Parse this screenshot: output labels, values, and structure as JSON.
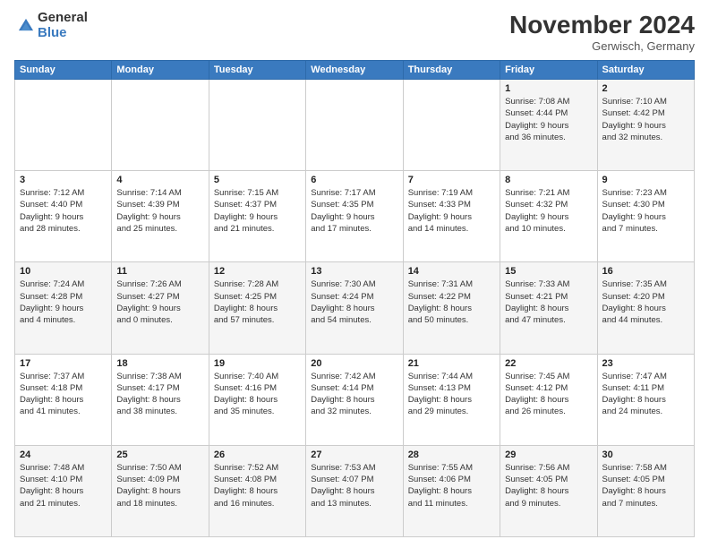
{
  "logo": {
    "general": "General",
    "blue": "Blue"
  },
  "header": {
    "month_title": "November 2024",
    "location": "Gerwisch, Germany"
  },
  "weekdays": [
    "Sunday",
    "Monday",
    "Tuesday",
    "Wednesday",
    "Thursday",
    "Friday",
    "Saturday"
  ],
  "weeks": [
    [
      {
        "day": "",
        "detail": ""
      },
      {
        "day": "",
        "detail": ""
      },
      {
        "day": "",
        "detail": ""
      },
      {
        "day": "",
        "detail": ""
      },
      {
        "day": "",
        "detail": ""
      },
      {
        "day": "1",
        "detail": "Sunrise: 7:08 AM\nSunset: 4:44 PM\nDaylight: 9 hours\nand 36 minutes."
      },
      {
        "day": "2",
        "detail": "Sunrise: 7:10 AM\nSunset: 4:42 PM\nDaylight: 9 hours\nand 32 minutes."
      }
    ],
    [
      {
        "day": "3",
        "detail": "Sunrise: 7:12 AM\nSunset: 4:40 PM\nDaylight: 9 hours\nand 28 minutes."
      },
      {
        "day": "4",
        "detail": "Sunrise: 7:14 AM\nSunset: 4:39 PM\nDaylight: 9 hours\nand 25 minutes."
      },
      {
        "day": "5",
        "detail": "Sunrise: 7:15 AM\nSunset: 4:37 PM\nDaylight: 9 hours\nand 21 minutes."
      },
      {
        "day": "6",
        "detail": "Sunrise: 7:17 AM\nSunset: 4:35 PM\nDaylight: 9 hours\nand 17 minutes."
      },
      {
        "day": "7",
        "detail": "Sunrise: 7:19 AM\nSunset: 4:33 PM\nDaylight: 9 hours\nand 14 minutes."
      },
      {
        "day": "8",
        "detail": "Sunrise: 7:21 AM\nSunset: 4:32 PM\nDaylight: 9 hours\nand 10 minutes."
      },
      {
        "day": "9",
        "detail": "Sunrise: 7:23 AM\nSunset: 4:30 PM\nDaylight: 9 hours\nand 7 minutes."
      }
    ],
    [
      {
        "day": "10",
        "detail": "Sunrise: 7:24 AM\nSunset: 4:28 PM\nDaylight: 9 hours\nand 4 minutes."
      },
      {
        "day": "11",
        "detail": "Sunrise: 7:26 AM\nSunset: 4:27 PM\nDaylight: 9 hours\nand 0 minutes."
      },
      {
        "day": "12",
        "detail": "Sunrise: 7:28 AM\nSunset: 4:25 PM\nDaylight: 8 hours\nand 57 minutes."
      },
      {
        "day": "13",
        "detail": "Sunrise: 7:30 AM\nSunset: 4:24 PM\nDaylight: 8 hours\nand 54 minutes."
      },
      {
        "day": "14",
        "detail": "Sunrise: 7:31 AM\nSunset: 4:22 PM\nDaylight: 8 hours\nand 50 minutes."
      },
      {
        "day": "15",
        "detail": "Sunrise: 7:33 AM\nSunset: 4:21 PM\nDaylight: 8 hours\nand 47 minutes."
      },
      {
        "day": "16",
        "detail": "Sunrise: 7:35 AM\nSunset: 4:20 PM\nDaylight: 8 hours\nand 44 minutes."
      }
    ],
    [
      {
        "day": "17",
        "detail": "Sunrise: 7:37 AM\nSunset: 4:18 PM\nDaylight: 8 hours\nand 41 minutes."
      },
      {
        "day": "18",
        "detail": "Sunrise: 7:38 AM\nSunset: 4:17 PM\nDaylight: 8 hours\nand 38 minutes."
      },
      {
        "day": "19",
        "detail": "Sunrise: 7:40 AM\nSunset: 4:16 PM\nDaylight: 8 hours\nand 35 minutes."
      },
      {
        "day": "20",
        "detail": "Sunrise: 7:42 AM\nSunset: 4:14 PM\nDaylight: 8 hours\nand 32 minutes."
      },
      {
        "day": "21",
        "detail": "Sunrise: 7:44 AM\nSunset: 4:13 PM\nDaylight: 8 hours\nand 29 minutes."
      },
      {
        "day": "22",
        "detail": "Sunrise: 7:45 AM\nSunset: 4:12 PM\nDaylight: 8 hours\nand 26 minutes."
      },
      {
        "day": "23",
        "detail": "Sunrise: 7:47 AM\nSunset: 4:11 PM\nDaylight: 8 hours\nand 24 minutes."
      }
    ],
    [
      {
        "day": "24",
        "detail": "Sunrise: 7:48 AM\nSunset: 4:10 PM\nDaylight: 8 hours\nand 21 minutes."
      },
      {
        "day": "25",
        "detail": "Sunrise: 7:50 AM\nSunset: 4:09 PM\nDaylight: 8 hours\nand 18 minutes."
      },
      {
        "day": "26",
        "detail": "Sunrise: 7:52 AM\nSunset: 4:08 PM\nDaylight: 8 hours\nand 16 minutes."
      },
      {
        "day": "27",
        "detail": "Sunrise: 7:53 AM\nSunset: 4:07 PM\nDaylight: 8 hours\nand 13 minutes."
      },
      {
        "day": "28",
        "detail": "Sunrise: 7:55 AM\nSunset: 4:06 PM\nDaylight: 8 hours\nand 11 minutes."
      },
      {
        "day": "29",
        "detail": "Sunrise: 7:56 AM\nSunset: 4:05 PM\nDaylight: 8 hours\nand 9 minutes."
      },
      {
        "day": "30",
        "detail": "Sunrise: 7:58 AM\nSunset: 4:05 PM\nDaylight: 8 hours\nand 7 minutes."
      }
    ]
  ]
}
